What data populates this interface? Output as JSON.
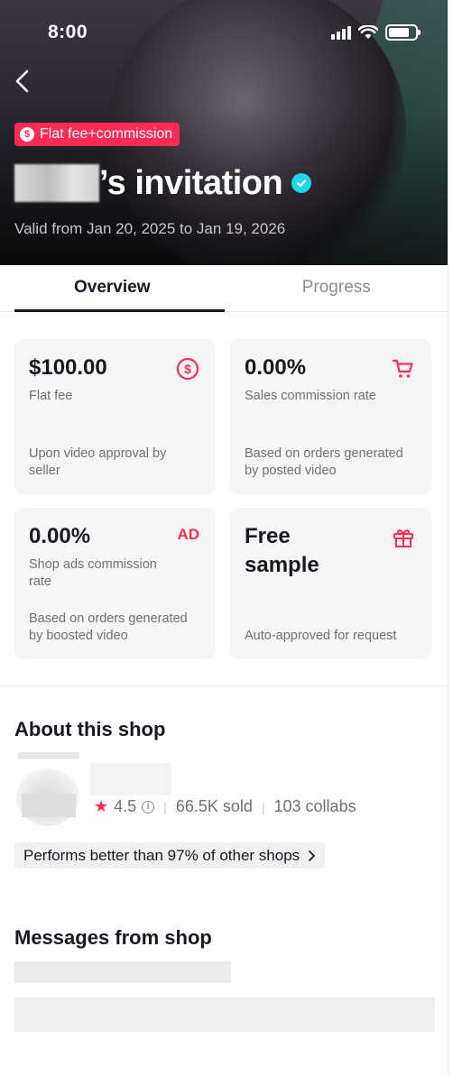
{
  "status_bar": {
    "time": "8:00"
  },
  "header": {
    "badge_label": "Flat fee+commission",
    "badge_icon": "dollar-circle-icon",
    "title_suffix": "’s invitation",
    "validity": "Valid from Jan 20, 2025 to Jan 19, 2026"
  },
  "tabs": [
    {
      "label": "Overview",
      "active": true
    },
    {
      "label": "Progress",
      "active": false
    }
  ],
  "cards": [
    {
      "value": "$100.00",
      "label": "Flat fee",
      "footnote": "Upon video approval by seller",
      "icon": "dollar-circle-icon"
    },
    {
      "value": "0.00%",
      "label": "Sales commission rate",
      "footnote": "Based on orders generated by posted video",
      "icon": "cart-icon"
    },
    {
      "value": "0.00%",
      "label": "Shop ads commission rate",
      "footnote": "Based on orders generated by boosted video",
      "icon_text": "AD"
    },
    {
      "value": "Free sample",
      "label": "",
      "footnote": "Auto-approved for request",
      "icon": "gift-icon"
    }
  ],
  "about": {
    "heading": "About this shop",
    "rating": "4.5",
    "sold": "66.5K sold",
    "collabs": "103 collabs",
    "performance": "Performs better than 97% of other shops"
  },
  "messages": {
    "heading": "Messages from shop"
  },
  "colors": {
    "accent": "#fe2c55",
    "verified": "#20d5ec",
    "text": "#161823",
    "muted": "#6f7076"
  }
}
